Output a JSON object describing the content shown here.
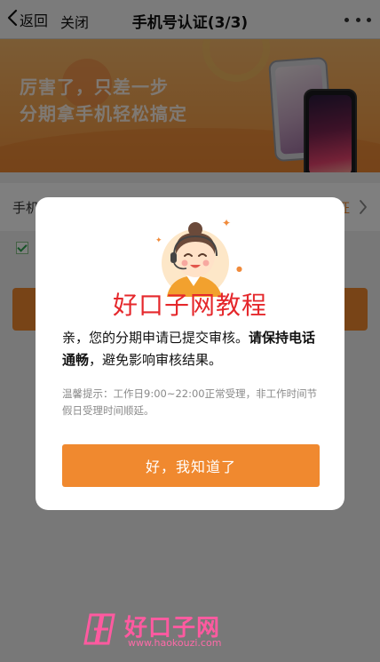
{
  "nav": {
    "back_label": "返回",
    "close_label": "关闭",
    "title": "手机号认证(3/3)"
  },
  "banner": {
    "line1": "厉害了，只差一步",
    "line2": "分期拿手机轻松搞定"
  },
  "form": {
    "row_label": "手机",
    "row_link": "证"
  },
  "dialog": {
    "watermark": "好口子网教程",
    "message_plain_1": "亲，您的分期申请已提交审核。",
    "message_bold_1": "请保持电话通畅",
    "message_plain_2": "，避免影响审核结果。",
    "tip": "温馨提示：工作日9:00~22:00正常受理，非工作时间节假日受理时间顺延。",
    "ok_label": "好，我知道了"
  },
  "watermark": {
    "name": "好口子网",
    "url": "www.haokouzi.com"
  },
  "colors": {
    "accent": "#f0892f",
    "watermark_red": "#e5282c",
    "watermark_pink": "#ff5aa0"
  },
  "icons": [
    "chevron-left-icon",
    "more-icon",
    "chevron-right-icon",
    "checkbox-icon",
    "agent-avatar-icon",
    "sparkle-icon",
    "logo-icon"
  ]
}
